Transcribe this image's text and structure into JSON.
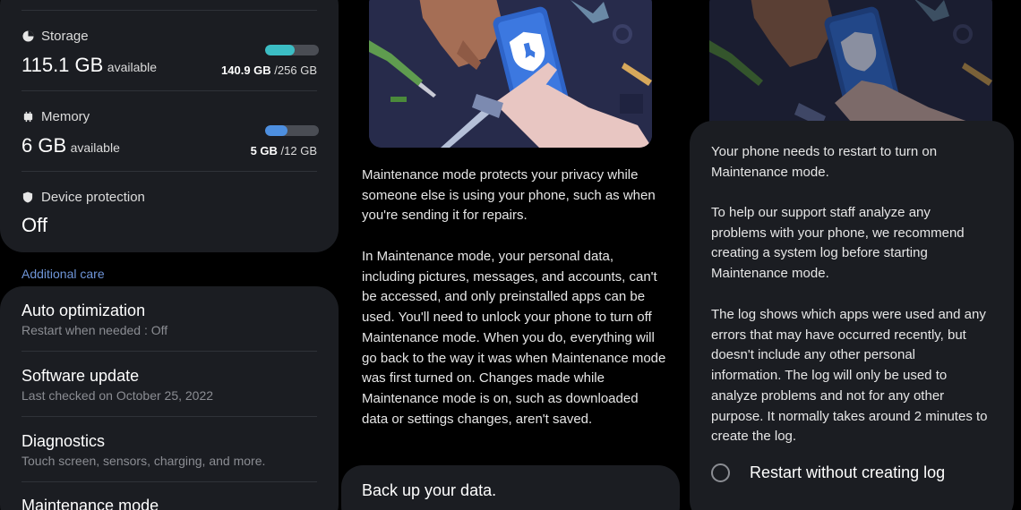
{
  "panel1": {
    "storage": {
      "label": "Storage",
      "value": "115.1 GB",
      "suffix": "available",
      "used": "140.9 GB",
      "total": "/256 GB",
      "fraction": 0.55,
      "color": "#3bbdc4"
    },
    "memory": {
      "label": "Memory",
      "value": "6 GB",
      "suffix": "available",
      "used": "5 GB",
      "total": "/12 GB",
      "fraction": 0.42,
      "color": "#4d8fe0"
    },
    "device_protection": {
      "label": "Device protection",
      "value": "Off"
    },
    "section_header": "Additional care",
    "items": [
      {
        "title": "Auto optimization",
        "subtitle": "Restart when needed : Off"
      },
      {
        "title": "Software update",
        "subtitle": "Last checked on October 25, 2022"
      },
      {
        "title": "Diagnostics",
        "subtitle": "Touch screen, sensors, charging, and more."
      },
      {
        "title": "Maintenance mode",
        "subtitle": ""
      }
    ]
  },
  "panel2": {
    "paragraph1": "Maintenance mode protects your privacy while someone else is using your phone, such as when you're sending it for repairs.",
    "paragraph2": "In Maintenance mode, your personal data, including pictures, messages, and accounts, can't be accessed, and only preinstalled apps can be used. You'll need to unlock your phone to turn off Maintenance mode. When you do, everything will go back to the way it was when Maintenance mode was first turned on. Changes made while Maintenance mode is on, such as downloaded data or settings changes, aren't saved.",
    "button_label": "Back up your data."
  },
  "panel3": {
    "paragraph1": "Your phone needs to restart to turn on Maintenance mode.",
    "paragraph2": "To help our support staff analyze any problems with your phone, we recommend creating a system log before starting Maintenance mode.",
    "paragraph3": "The log shows which apps were used and any errors that may have occurred recently, but doesn't include any other personal information. The log will only be used to analyze problems and not for any other purpose. It normally takes around 2 minutes to create the log.",
    "option_label": "Restart without creating log"
  },
  "colors": {
    "card_bg": "#1b1d22",
    "accent_link": "#6f95d8",
    "illustration_bg": "#272b4b"
  }
}
